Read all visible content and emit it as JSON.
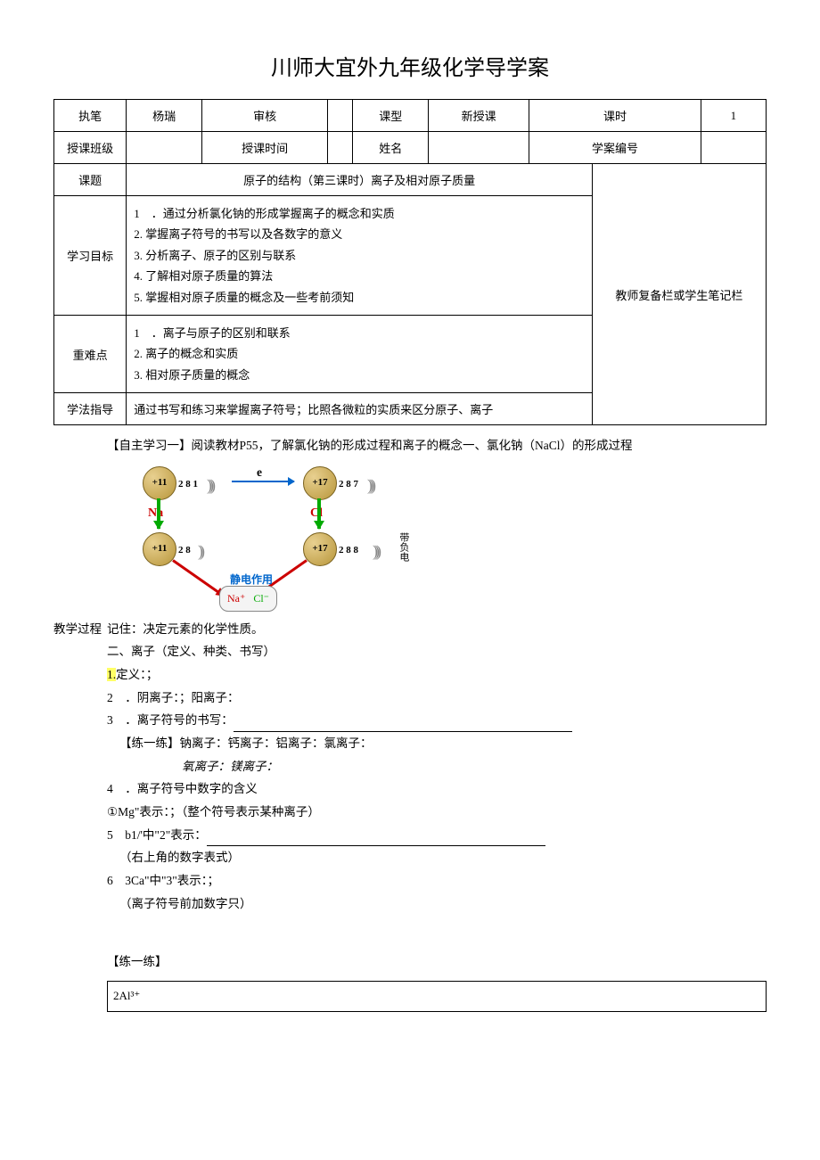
{
  "title": "川师大宜外九年级化学导学案",
  "header": {
    "r1c1": "执笔",
    "r1c2": "杨瑞",
    "r1c3": "审核",
    "r1c4": "",
    "r1c5": "课型",
    "r1c6": "新授课",
    "r1c7": "课时",
    "r1c8": "1",
    "r2c1": "授课班级",
    "r2c2": "",
    "r2c3": "授课时间",
    "r2c4": "",
    "r2c5": "姓名",
    "r2c6": "",
    "r2c7": "学案编号",
    "r2c8": "",
    "r3c1": "课题",
    "r3c2": "原子的结构（第三课时）离子及相对原子质量",
    "r3c3": "教师复备栏或学生笔记栏",
    "r4c1": "学习目标",
    "goal1": "1　．通过分析氯化钠的形成掌握离子的概念和实质",
    "goal2": "2. 掌握离子符号的书写以及各数字的意义",
    "goal3": "3. 分析离子、原子的区别与联系",
    "goal4": "4. 了解相对原子质量的算法",
    "goal5": "5. 掌握相对原子质量的概念及一些考前须知",
    "r5c1": "重难点",
    "diff1": "1　．离子与原子的区别和联系",
    "diff2": "2. 离子的概念和实质",
    "diff3": "3. 相对原子质量的概念",
    "r6c1": "学法指导",
    "r6c2": "通过书写和练习来掌握离子符号；比照各微粒的实质来区分原子、离子"
  },
  "process_label": "教学过程",
  "content": {
    "line1": "【自主学习一】阅读教材P55，了解氯化钠的形成过程和离子的概念一、氯化钠（NaCl）的形成过程",
    "diagram": {
      "na_nucleus": "+11",
      "na_shells": "2 8 1",
      "cl_nucleus": "+17",
      "cl_shells": "2 8 7",
      "na_ion_nucleus": "+11",
      "na_ion_shells": "2 8",
      "cl_ion_nucleus": "+17",
      "cl_ion_shells": "2 8 8",
      "e_label": "e",
      "na_label": "Na",
      "cl_label": "Cl",
      "static_label": "静电作用",
      "na_plus": "Na⁺",
      "cl_minus": "Cl⁻",
      "charge_label": "带负电"
    },
    "line2": "记住：决定元素的化学性质。",
    "line3": "二、离子（定义、种类、书写）",
    "line4a": "1.",
    "line4b": "定义：；",
    "line5": "2　．阴离子：；阳离子：",
    "line6a": "3　．离子符号的书写：",
    "line7": "【练一练】钠离子：钙离子：铝离子：氯离子：",
    "line7b": "氧离子：镁离子：",
    "line8": "4　．离子符号中数字的含义",
    "line9": "①Mg\"表示：；（整个符号表示某种离子）",
    "line10a": "5　b1/'中\"2\"表示：",
    "line11": "（右上角的数字表式）",
    "line12": "6　3Ca\"中\"3\"表示：；",
    "line13": "（离子符号前加数字只）",
    "practice_label": "【练一练】",
    "practice_content": "2Al³⁺"
  }
}
